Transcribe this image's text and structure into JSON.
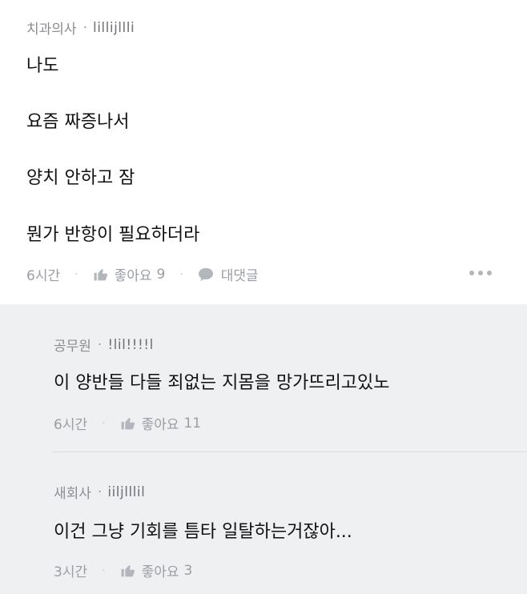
{
  "main_comment": {
    "company": "치과의사",
    "separator": "·",
    "nickname": "lillijllli",
    "lines": [
      "나도",
      "요즘 짜증나서",
      "양치 안하고 잠",
      "뭔가 반항이 필요하더라"
    ],
    "time": "6시간",
    "like_label": "좋아요",
    "like_count": "9",
    "reply_label": "대댓글",
    "more_icon": "more-dots-icon"
  },
  "replies": [
    {
      "company": "공무원",
      "separator": "·",
      "nickname": "!lil!!!!l",
      "text": "이 양반들 다들 죄없는 지몸을 망가뜨리고있노",
      "time": "6시간",
      "like_label": "좋아요",
      "like_count": "11"
    },
    {
      "company": "새회사",
      "separator": "·",
      "nickname": "iiljlllil",
      "text": "이건 그냥 기회를 틈타 일탈하는거잖아...",
      "time": "3시간",
      "like_label": "좋아요",
      "like_count": "3"
    }
  ],
  "colors": {
    "reply_background": "#eff0f2",
    "meta_gray": "#9a9da4",
    "text": "#111111"
  }
}
